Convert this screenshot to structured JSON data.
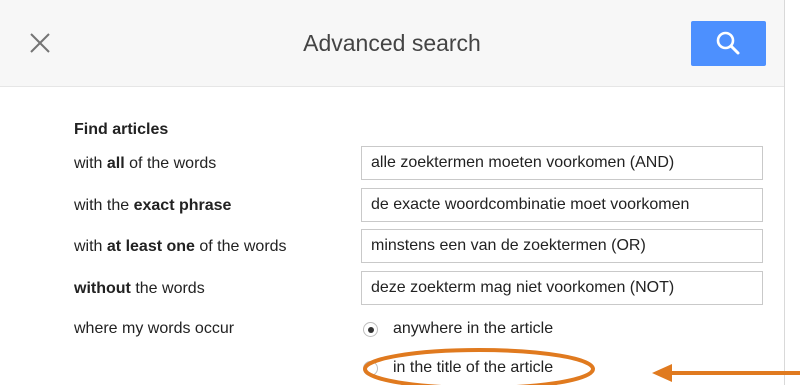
{
  "dialog": {
    "title": "Advanced search",
    "close_icon": "close-icon",
    "search_icon": "search-icon",
    "accent_color": "#4d90fe"
  },
  "form": {
    "section_title": "Find articles",
    "rows": [
      {
        "pre": "with ",
        "bold": "all",
        "post": " of the words",
        "value": "alle zoektermen moeten voorkomen (AND)"
      },
      {
        "pre": "with the ",
        "bold": "exact phrase",
        "post": "",
        "value": "de exacte woordcombinatie moet voorkomen"
      },
      {
        "pre": "with ",
        "bold": "at least one",
        "post": " of the words",
        "value": "minstens een van de zoektermen (OR)"
      },
      {
        "pre": "",
        "bold": "without",
        "post": " the words",
        "value": "deze zoekterm mag niet voorkomen (NOT)"
      }
    ],
    "occur_label": "where my words occur",
    "occur_options": [
      {
        "label": "anywhere in the article",
        "selected": true
      },
      {
        "label": "in the title of the article",
        "selected": false
      }
    ]
  },
  "annotation": {
    "color": "#e07a1f"
  }
}
